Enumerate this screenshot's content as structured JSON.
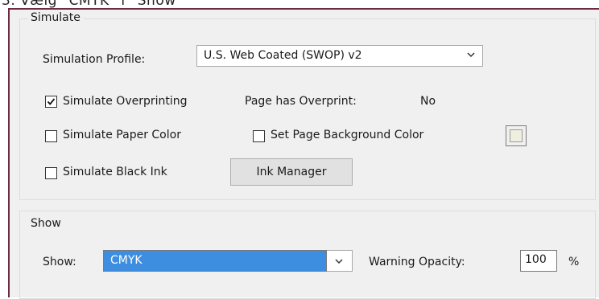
{
  "caption": "3. Vælg “CMYK” i “Show”",
  "simulate": {
    "legend": "Simulate",
    "profile_label": "Simulation Profile:",
    "profile_value": "U.S. Web Coated (SWOP) v2",
    "overprinting": {
      "label": "Simulate Overprinting",
      "checked": true
    },
    "page_overprint_label": "Page has Overprint:",
    "page_overprint_value": "No",
    "paper_color": {
      "label": "Simulate Paper Color",
      "checked": false
    },
    "page_bg_color": {
      "label": "Set Page Background Color",
      "checked": false
    },
    "black_ink": {
      "label": "Simulate Black Ink",
      "checked": false
    },
    "ink_manager_label": "Ink Manager"
  },
  "show": {
    "legend": "Show",
    "show_label": "Show:",
    "show_value": "CMYK",
    "warning_label": "Warning Opacity:",
    "warning_value": "100",
    "percent": "%"
  }
}
